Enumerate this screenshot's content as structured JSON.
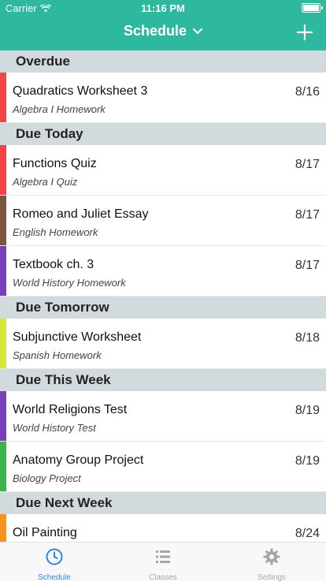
{
  "status_bar": {
    "carrier": "Carrier",
    "time": "11:16 PM"
  },
  "nav": {
    "title": "Schedule",
    "dropdown_icon": "chevron-down-icon",
    "add_icon": "plus-icon"
  },
  "colors": {
    "header": "#2eb89e",
    "section_bg": "#d3dadd",
    "tab_active": "#2e86de",
    "tab_inactive": "#a6a6a6"
  },
  "sections": [
    {
      "title": "Overdue",
      "items": [
        {
          "title": "Quadratics Worksheet 3",
          "subtitle": "Algebra I Homework",
          "date": "8/16",
          "color": "#f24444"
        }
      ]
    },
    {
      "title": "Due Today",
      "items": [
        {
          "title": "Functions Quiz",
          "subtitle": "Algebra I Quiz",
          "date": "8/17",
          "color": "#f24444"
        },
        {
          "title": "Romeo and Juliet Essay",
          "subtitle": "English Homework",
          "date": "8/17",
          "color": "#7b5540"
        },
        {
          "title": "Textbook ch. 3",
          "subtitle": "World History Homework",
          "date": "8/17",
          "color": "#7a3fb8"
        }
      ]
    },
    {
      "title": "Due Tomorrow",
      "items": [
        {
          "title": "Subjunctive Worksheet",
          "subtitle": "Spanish Homework",
          "date": "8/18",
          "color": "#d6e63a"
        }
      ]
    },
    {
      "title": "Due This Week",
      "items": [
        {
          "title": "World Religions Test",
          "subtitle": "World History Test",
          "date": "8/19",
          "color": "#7a3fb8"
        },
        {
          "title": "Anatomy Group Project",
          "subtitle": "Biology Project",
          "date": "8/19",
          "color": "#3cb44b"
        }
      ]
    },
    {
      "title": "Due Next Week",
      "items": [
        {
          "title": "Oil Painting",
          "subtitle": "",
          "date": "8/24",
          "color": "#f7941d"
        }
      ]
    }
  ],
  "tabs": [
    {
      "label": "Schedule",
      "icon": "clock-icon",
      "active": true
    },
    {
      "label": "Classes",
      "icon": "list-icon",
      "active": false
    },
    {
      "label": "Settings",
      "icon": "gear-icon",
      "active": false
    }
  ]
}
